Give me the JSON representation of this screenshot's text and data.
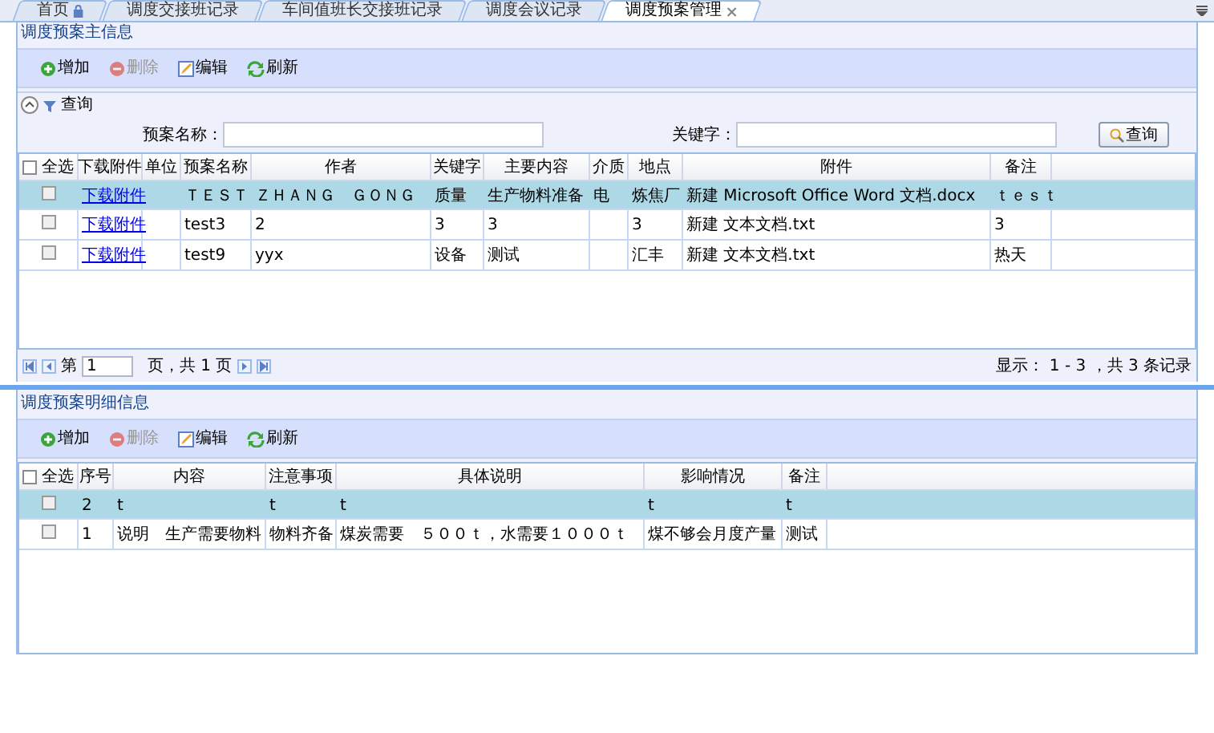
{
  "tabs": [
    {
      "label": "首页",
      "selected": false,
      "kind": "locked"
    },
    {
      "label": "调度交接班记录",
      "selected": false,
      "kind": "plain"
    },
    {
      "label": "车间值班长交接班记录",
      "selected": false,
      "kind": "plain"
    },
    {
      "label": "调度会议记录",
      "selected": false,
      "kind": "plain"
    },
    {
      "label": "调度预案管理",
      "selected": true,
      "kind": "closable"
    }
  ],
  "main": {
    "title": "调度预案主信息",
    "toolbar": [
      {
        "kind": "add",
        "label": "增加",
        "disabled": false
      },
      {
        "kind": "delete",
        "label": "删除",
        "disabled": true
      },
      {
        "kind": "edit",
        "label": "编辑",
        "disabled": false
      },
      {
        "kind": "refresh",
        "label": "刷新",
        "disabled": false
      }
    ],
    "query": {
      "title": "查询",
      "expanded": true,
      "fields": [
        {
          "label": "预案名称："
        },
        {
          "label": "关键字："
        }
      ],
      "button": "查询"
    },
    "table": {
      "select_all": "全选",
      "select_all_checked": false,
      "columns": [
        "下载附件",
        "单位",
        "预案名称",
        "作者",
        "关键字",
        "主要内容",
        "介质",
        "地点",
        "附件",
        "备注"
      ],
      "rows": [
        {
          "selected": true,
          "checked": false,
          "cells": [
            "下载附件",
            "",
            "ＴＥＳＴ",
            "ＺＨＡＮＧ　ＧＯＮＧ",
            "质量",
            "生产物料准备",
            "电",
            "炼焦厂",
            "新建 Microsoft Office Word 文档.docx",
            "ｔｅｓｔ"
          ]
        },
        {
          "selected": false,
          "checked": false,
          "cells": [
            "下载附件",
            "",
            "test3",
            "2",
            "3",
            "3",
            "",
            "3",
            "新建 文本文档.txt",
            "3"
          ]
        },
        {
          "selected": false,
          "checked": false,
          "cells": [
            "下载附件",
            "",
            "test9",
            "yyx",
            "设备",
            "测试",
            "",
            "汇丰",
            "新建 文本文档.txt",
            "热天"
          ]
        }
      ]
    },
    "pager": {
      "before": "第",
      "page": "1",
      "after": "页，共 1 页",
      "summary": "显示： 1 - 3 ，共 3 条记录"
    }
  },
  "detail": {
    "title": "调度预案明细信息",
    "toolbar": [
      {
        "kind": "add",
        "label": "增加",
        "disabled": false
      },
      {
        "kind": "delete",
        "label": "删除",
        "disabled": true
      },
      {
        "kind": "edit",
        "label": "编辑",
        "disabled": false
      },
      {
        "kind": "refresh",
        "label": "刷新",
        "disabled": false
      }
    ],
    "table": {
      "select_all": "全选",
      "select_all_checked": false,
      "columns": [
        "序号",
        "内容",
        "注意事项",
        "具体说明",
        "影响情况",
        "备注"
      ],
      "rows": [
        {
          "selected": true,
          "checked": false,
          "cells": [
            "2",
            "t",
            "t",
            "t",
            "t",
            "t"
          ]
        },
        {
          "selected": false,
          "checked": false,
          "cells": [
            "1",
            "说明　生产需要物料",
            "物料齐备",
            "煤炭需要　５００ｔ，水需要１０００ｔ",
            "煤不够会月度产量",
            "测试"
          ]
        }
      ]
    }
  }
}
